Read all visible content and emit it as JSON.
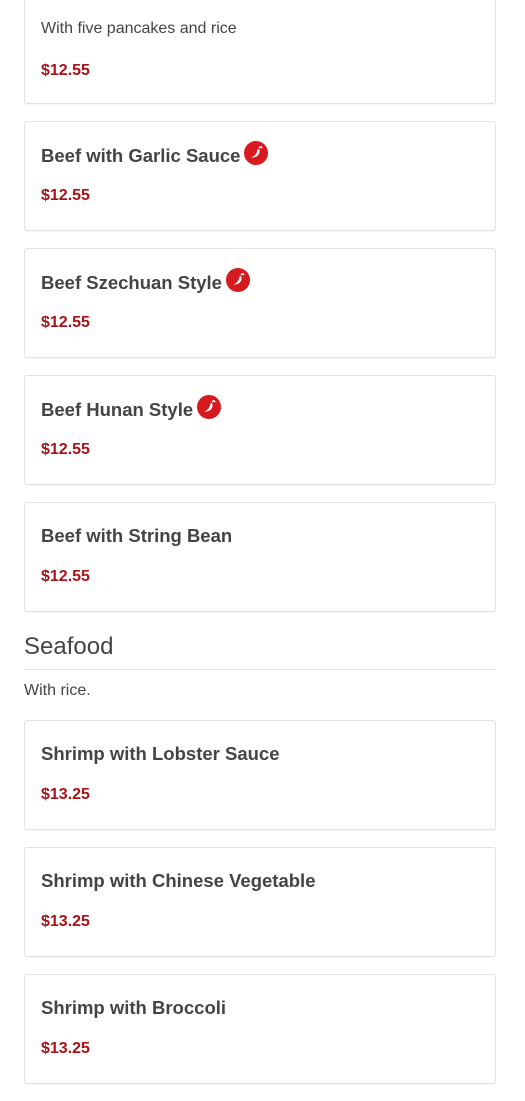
{
  "colors": {
    "price": "#a8131a",
    "spicy_icon": "#d71920",
    "text": "#444444",
    "border": "#e3e3e3"
  },
  "items_top": [
    {
      "name": "",
      "description": "With five pancakes and rice",
      "price": "$12.55",
      "spicy": false
    },
    {
      "name": "Beef with Garlic Sauce",
      "description": "",
      "price": "$12.55",
      "spicy": true
    },
    {
      "name": "Beef Szechuan Style",
      "description": "",
      "price": "$12.55",
      "spicy": true
    },
    {
      "name": "Beef Hunan Style",
      "description": "",
      "price": "$12.55",
      "spicy": true
    },
    {
      "name": "Beef with String Bean",
      "description": "",
      "price": "$12.55",
      "spicy": false
    }
  ],
  "seafood": {
    "title": "Seafood",
    "description": "With rice.",
    "items": [
      {
        "name": "Shrimp with Lobster Sauce",
        "price": "$13.25",
        "spicy": false
      },
      {
        "name": "Shrimp with Chinese Vegetable",
        "price": "$13.25",
        "spicy": false
      },
      {
        "name": "Shrimp with Broccoli",
        "price": "$13.25",
        "spicy": false
      }
    ]
  },
  "icons": {
    "spicy": "chili-pepper-icon"
  }
}
